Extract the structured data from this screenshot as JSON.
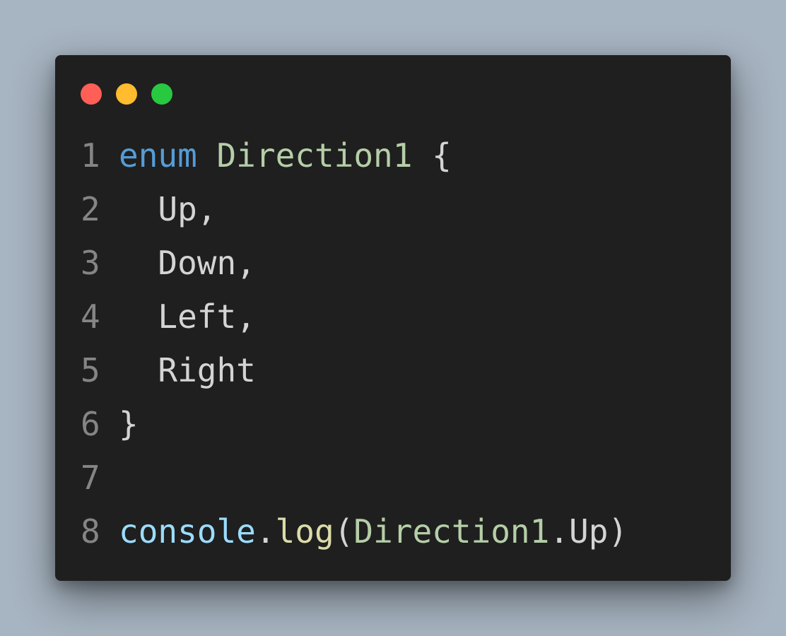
{
  "window": {
    "controls": [
      {
        "name": "close",
        "color": "#ff5f57"
      },
      {
        "name": "minimize",
        "color": "#febc2e"
      },
      {
        "name": "maximize",
        "color": "#28c840"
      }
    ]
  },
  "colors": {
    "keyword": "#569cd6",
    "type": "#b5cea8",
    "plain": "#d4d4d4",
    "variable": "#9cdcfe",
    "function": "#dcdcaa",
    "line_number": "#858585"
  },
  "lines": [
    {
      "number": "1",
      "tokens": [
        {
          "text": "enum",
          "kind": "keyword"
        },
        {
          "text": " ",
          "kind": "plain"
        },
        {
          "text": "Direction1",
          "kind": "type"
        },
        {
          "text": " {",
          "kind": "plain"
        }
      ]
    },
    {
      "number": "2",
      "tokens": [
        {
          "text": "  Up,",
          "kind": "plain"
        }
      ]
    },
    {
      "number": "3",
      "tokens": [
        {
          "text": "  Down,",
          "kind": "plain"
        }
      ]
    },
    {
      "number": "4",
      "tokens": [
        {
          "text": "  Left,",
          "kind": "plain"
        }
      ]
    },
    {
      "number": "5",
      "tokens": [
        {
          "text": "  Right",
          "kind": "plain"
        }
      ]
    },
    {
      "number": "6",
      "tokens": [
        {
          "text": "}",
          "kind": "plain"
        }
      ]
    },
    {
      "number": "7",
      "tokens": []
    },
    {
      "number": "8",
      "tokens": [
        {
          "text": "console",
          "kind": "variable"
        },
        {
          "text": ".",
          "kind": "plain"
        },
        {
          "text": "log",
          "kind": "function"
        },
        {
          "text": "(",
          "kind": "plain"
        },
        {
          "text": "Direction1",
          "kind": "type"
        },
        {
          "text": ".Up)",
          "kind": "plain"
        }
      ]
    }
  ]
}
